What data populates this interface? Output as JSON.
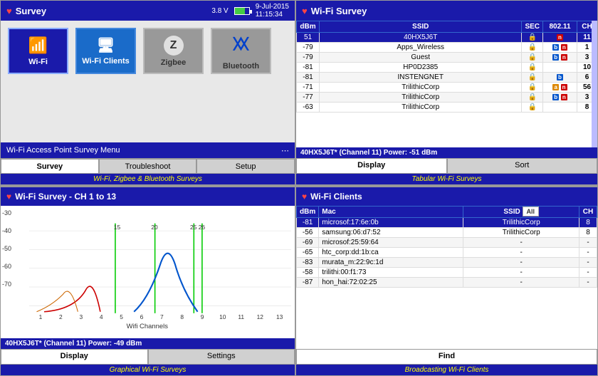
{
  "header": {
    "title": "Survey",
    "voltage": "3.8 V",
    "date": "9-Jul-2015",
    "time": "11:15:34"
  },
  "left_panel": {
    "buttons": [
      {
        "label": "Wi-Fi",
        "type": "wifi",
        "selected": false
      },
      {
        "label": "Wi-Fi Clients",
        "type": "clients",
        "selected": false
      },
      {
        "label": "Zigbee",
        "type": "zigbee",
        "selected": false
      },
      {
        "label": "Bluetooth",
        "type": "bluetooth",
        "selected": false
      }
    ],
    "menu_title": "Wi-Fi Access Point Survey Menu",
    "tabs": [
      "Survey",
      "Troubleshoot",
      "Setup"
    ],
    "caption": "Wi-Fi, Zigbee & Bluetooth Surveys"
  },
  "wifi_survey": {
    "title": "Wi-Fi Survey",
    "columns": [
      "dBm",
      "SSID",
      "SEC",
      "802.11",
      "CH"
    ],
    "rows": [
      {
        "dbm": "51",
        "ssid": "40HX5J6T",
        "sec": true,
        "standards": [
          "n"
        ],
        "ch": "11",
        "selected": true
      },
      {
        "dbm": "-79",
        "ssid": "Apps_Wireless",
        "sec": true,
        "standards": [
          "b",
          "n"
        ],
        "ch": "1"
      },
      {
        "dbm": "-79",
        "ssid": "Guest",
        "sec": true,
        "standards": [
          "b",
          "n"
        ],
        "ch": "3"
      },
      {
        "dbm": "-81",
        "ssid": "HP0D2385",
        "sec": true,
        "standards": [],
        "ch": "10"
      },
      {
        "dbm": "-81",
        "ssid": "INSTENGNET",
        "sec": true,
        "standards": [
          "b"
        ],
        "ch": "6"
      },
      {
        "dbm": "-71",
        "ssid": "TrilithicCorp",
        "sec": true,
        "standards": [
          "a",
          "n"
        ],
        "ch": "56"
      },
      {
        "dbm": "-77",
        "ssid": "TrilithicCorp",
        "sec": true,
        "standards": [
          "b",
          "n"
        ],
        "ch": "3"
      },
      {
        "dbm": "-63",
        "ssid": "TrilithicCorp",
        "sec": true,
        "standards": [],
        "ch": "8"
      }
    ],
    "selected_info": "40HX5J6T* (Channel 11) Power: -51 dBm",
    "tabs": [
      "Display",
      "Sort"
    ],
    "caption": "Tabular Wi-Fi Surveys"
  },
  "graph": {
    "title": "Wi-Fi Survey - CH 1 to 13",
    "y_labels": [
      "-30",
      "-40",
      "-50",
      "-60",
      "-70"
    ],
    "x_labels": [
      "1",
      "2",
      "3",
      "4",
      "5",
      "6",
      "7",
      "8",
      "9",
      "10",
      "11",
      "12",
      "13"
    ],
    "channel_markers": [
      "15",
      "20",
      "25",
      "26"
    ],
    "selected_info": "40HX5J6T* (Channel 11) Power: -49 dBm",
    "tabs": [
      "Display",
      "Settings"
    ],
    "caption": "Graphical Wi-Fi Surveys"
  },
  "wifi_clients": {
    "title": "Wi-Fi Clients",
    "filter": "All",
    "columns": [
      "dBm",
      "Mac",
      "SSID",
      "CH"
    ],
    "rows": [
      {
        "dbm": "-81",
        "mac": "microsof:17:6e:0b",
        "ssid": "TrilithicCorp",
        "ch": "8",
        "selected": true
      },
      {
        "dbm": "-56",
        "mac": "samsung:06:d7:52",
        "ssid": "TrilithicCorp",
        "ch": "8"
      },
      {
        "dbm": "-69",
        "mac": "microsof:25:59:64",
        "ssid": "",
        "ch": "-"
      },
      {
        "dbm": "-65",
        "mac": "htc_corp:dd:1b:ca",
        "ssid": "",
        "ch": "-"
      },
      {
        "dbm": "-83",
        "mac": "murata_m:22:9c:1d",
        "ssid": "",
        "ch": "-"
      },
      {
        "dbm": "-58",
        "mac": "trilithi:00:f1:73",
        "ssid": "",
        "ch": "-"
      },
      {
        "dbm": "-87",
        "mac": "hon_hai:72:02:25",
        "ssid": "",
        "ch": "-"
      }
    ],
    "tabs": [
      "Find"
    ],
    "caption": "Broadcasting Wi-Fi Clients"
  }
}
